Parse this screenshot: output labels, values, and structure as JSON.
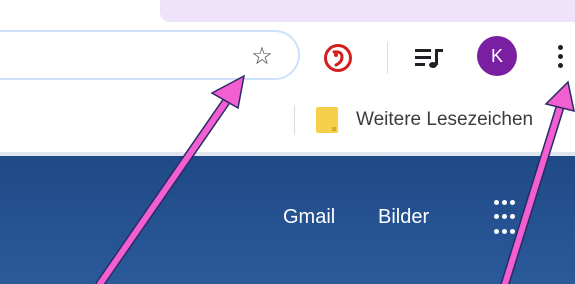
{
  "toolbar": {
    "bookmark_star": "☆",
    "extension_glyph": "",
    "avatar_initial": "K",
    "icons": [
      "star-icon",
      "extension-icon",
      "media-control-icon",
      "avatar",
      "three-dot-menu-icon"
    ]
  },
  "bookmarks": {
    "folder_label": "Weitere Lesezeichen"
  },
  "page": {
    "links": [
      "Gmail",
      "Bilder"
    ],
    "apps_icon": "apps-grid-icon"
  },
  "colors": {
    "accent_tab": "#efe3fb",
    "avatar": "#7b1fa2",
    "extension_red": "#d41e1e",
    "page_blue": "#24508f",
    "annotation_arrow": "#f25fd1"
  }
}
